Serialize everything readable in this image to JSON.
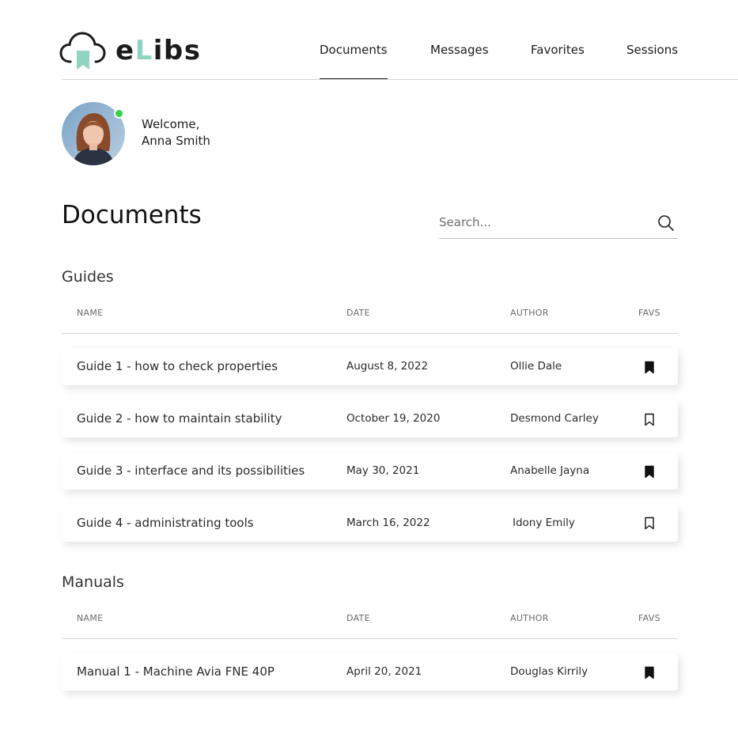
{
  "brand": {
    "name_prefix": "e",
    "name_accent": "L",
    "name_suffix": "ibs",
    "accent_color": "#8fd3c1"
  },
  "nav": {
    "items": [
      {
        "label": "Documents",
        "active": true
      },
      {
        "label": "Messages",
        "active": false
      },
      {
        "label": "Favorites",
        "active": false
      },
      {
        "label": "Sessions",
        "active": false
      }
    ]
  },
  "user": {
    "greeting": "Welcome,",
    "name": "Anna Smith",
    "status_color": "#31d24a"
  },
  "page": {
    "title": "Documents"
  },
  "search": {
    "placeholder": "Search..."
  },
  "columns": {
    "name": "NAME",
    "date": "DATE",
    "author": "AUTHOR",
    "favs": "FAVS"
  },
  "sections": [
    {
      "title": "Guides",
      "rows": [
        {
          "name": "Guide 1 - how to check properties",
          "date": "August 8, 2022",
          "author": "Ollie Dale",
          "favorite": true
        },
        {
          "name": "Guide 2 - how to maintain stability",
          "date": "October 19, 2020",
          "author": "Desmond Carley",
          "favorite": false
        },
        {
          "name": "Guide 3 - interface and its possibilities",
          "date": "May 30, 2021",
          "author": "Anabelle Jayna",
          "favorite": true
        },
        {
          "name": "Guide 4 - administrating tools",
          "date": "March 16, 2022",
          "author": "Idony Emily",
          "favorite": false
        }
      ]
    },
    {
      "title": "Manuals",
      "rows": [
        {
          "name": "Manual 1 - Machine Avia FNE 40P",
          "date": "April 20, 2021",
          "author": "Douglas Kirrily",
          "favorite": true
        }
      ]
    }
  ],
  "icons": {
    "logo": "cloud-bookmark-icon",
    "search": "search-icon",
    "favorite_on": "bookmark-filled-icon",
    "favorite_off": "bookmark-outline-icon"
  }
}
